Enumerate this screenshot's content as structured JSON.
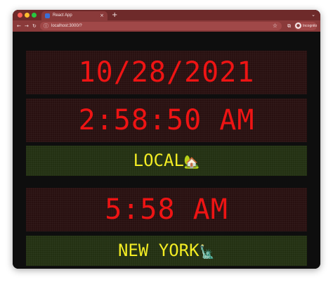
{
  "browser": {
    "tab_title": "React App",
    "tab_close": "×",
    "new_tab": "+",
    "window_menu": "⌄",
    "url": "localhost:3000/?",
    "incognito_label": "Incognito",
    "icons": {
      "back": "←",
      "forward": "→",
      "reload": "↻",
      "info": "ⓘ",
      "star": "☆",
      "extension": "⧉",
      "incognito": "●"
    }
  },
  "clock": {
    "date": "10/28/2021",
    "local_time": "2:58:50 AM",
    "local_label": "LOCAL",
    "local_emoji": "🏡",
    "ny_time": "5:58 AM",
    "ny_label": "NEW YORK",
    "ny_emoji": "🗽"
  },
  "colors": {
    "titlebar": "#6e2a2a",
    "toolbar": "#8a3a3a",
    "page_bg": "#0e0e0e",
    "red_panel_bg": "#281010",
    "red_text": "#ee1414",
    "green_panel_bg": "#233012",
    "yellow_text": "#f2ec24"
  }
}
